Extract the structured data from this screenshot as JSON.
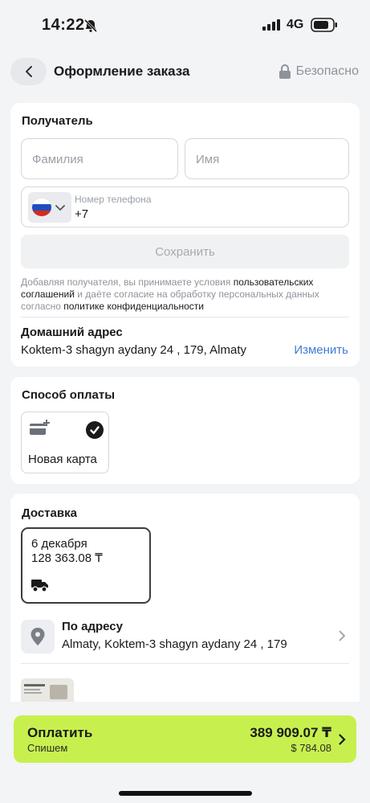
{
  "status_bar": {
    "time": "14:22",
    "network": "4G"
  },
  "header": {
    "title": "Оформление заказа",
    "secure_label": "Безопасно"
  },
  "recipient": {
    "title": "Получатель",
    "last_name_placeholder": "Фамилия",
    "first_name_placeholder": "Имя",
    "phone_label": "Номер телефона",
    "phone_value": "+7",
    "save_button": "Сохранить",
    "consent_part1": "Добавляя получателя, вы принимаете условия ",
    "consent_link1": "пользовательских соглашений",
    "consent_part2": " и даёте согласие на обработку персональных данных согласно ",
    "consent_link2": "политике конфиденциальности",
    "home_address_title": "Домашний адрес",
    "home_address_value": "Koktem-3 shagyn aydany 24 , 179, Almaty",
    "change_link": "Изменить"
  },
  "payment": {
    "title": "Способ оплаты",
    "new_card_label": "Новая карта"
  },
  "delivery": {
    "title": "Доставка",
    "date": "6 декабря",
    "price": "128 363.08 ₸",
    "method_title": "По адресу",
    "method_address": "Almaty, Koktem-3 shagyn aydany 24 , 179"
  },
  "checkout": {
    "pay_label": "Оплатить",
    "sub_label": "Спишем",
    "amount": "389 909.07 ₸",
    "amount_usd": "$ 784.08"
  },
  "colors": {
    "accent_green": "#c7f04e",
    "link_blue": "#3f7ad8"
  }
}
